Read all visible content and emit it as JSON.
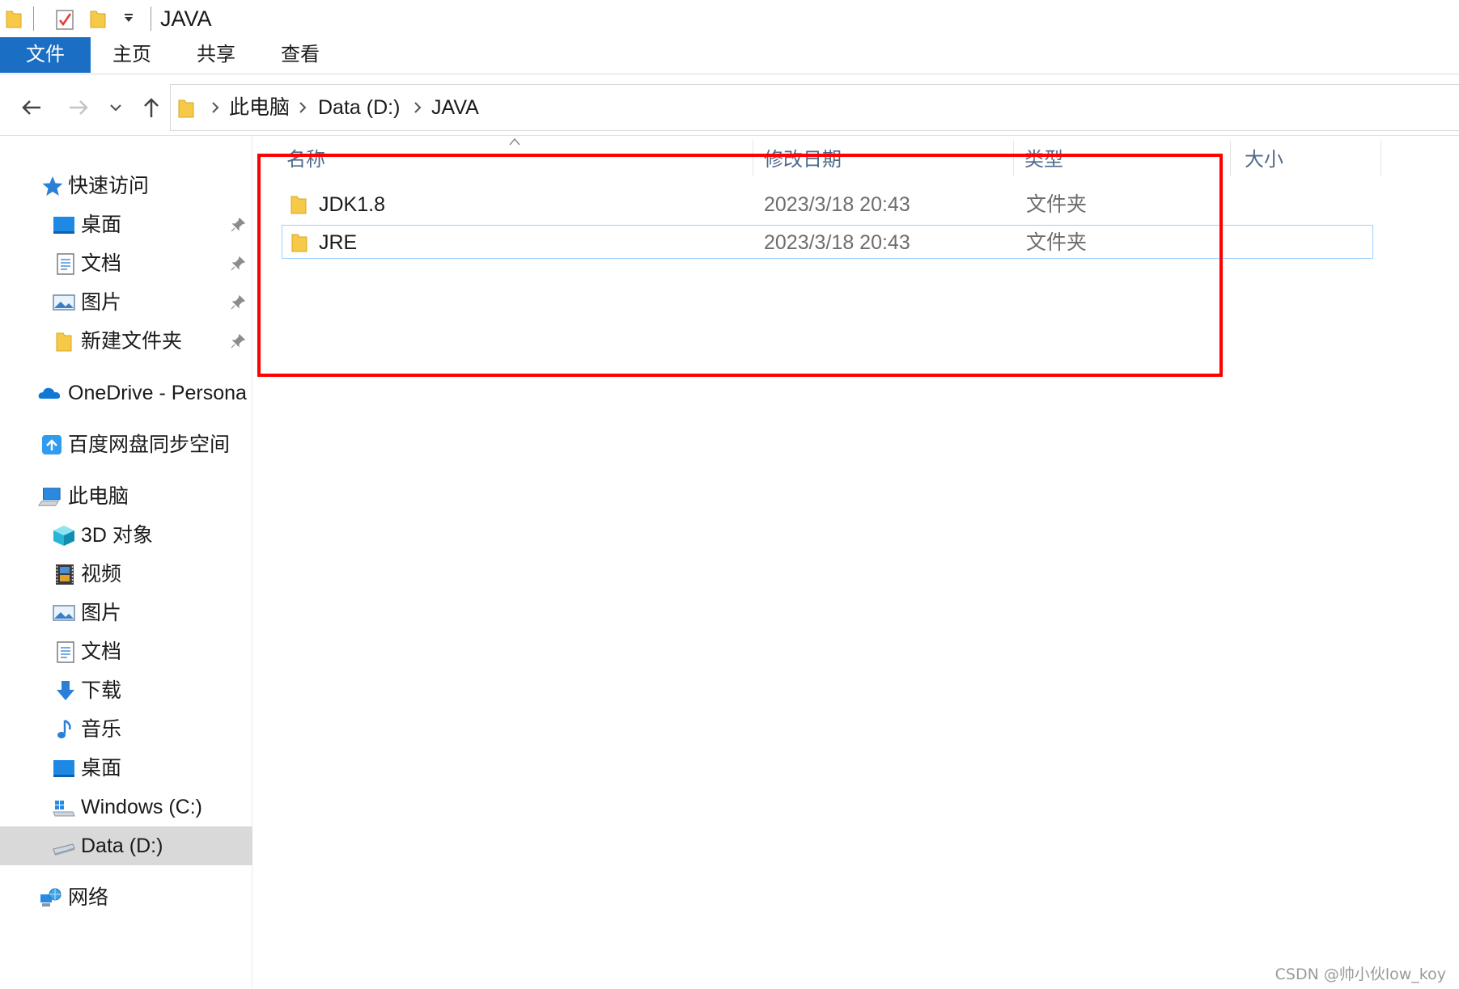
{
  "window": {
    "title": "JAVA"
  },
  "quick_access_toolbar": {
    "icons": [
      "folder-icon",
      "properties-checkmark-icon",
      "new-folder-icon",
      "customize-dropdown-icon"
    ]
  },
  "ribbon": {
    "tabs": [
      {
        "label": "文件",
        "active": true
      },
      {
        "label": "主页"
      },
      {
        "label": "共享"
      },
      {
        "label": "查看"
      }
    ]
  },
  "address_bar": {
    "breadcrumbs": [
      "此电脑",
      "Data (D:)",
      "JAVA"
    ]
  },
  "sidebar": {
    "quick_access": {
      "label": "快速访问",
      "items": [
        {
          "label": "桌面",
          "icon": "desktop-icon",
          "pinned": true
        },
        {
          "label": "文档",
          "icon": "documents-icon",
          "pinned": true
        },
        {
          "label": "图片",
          "icon": "pictures-icon",
          "pinned": true
        },
        {
          "label": "新建文件夹",
          "icon": "folder-icon",
          "pinned": true
        }
      ]
    },
    "onedrive": {
      "label": "OneDrive - Persona"
    },
    "baidu": {
      "label": "百度网盘同步空间"
    },
    "this_pc": {
      "label": "此电脑",
      "items": [
        {
          "label": "3D 对象",
          "icon": "3d-objects-icon"
        },
        {
          "label": "视频",
          "icon": "videos-icon"
        },
        {
          "label": "图片",
          "icon": "pictures-icon"
        },
        {
          "label": "文档",
          "icon": "documents-icon"
        },
        {
          "label": "下载",
          "icon": "downloads-icon"
        },
        {
          "label": "音乐",
          "icon": "music-icon"
        },
        {
          "label": "桌面",
          "icon": "desktop-icon"
        },
        {
          "label": "Windows (C:)",
          "icon": "windows-drive-icon"
        },
        {
          "label": "Data (D:)",
          "icon": "drive-icon",
          "selected": true
        }
      ]
    },
    "network": {
      "label": "网络"
    }
  },
  "file_list": {
    "columns": [
      "名称",
      "修改日期",
      "类型",
      "大小"
    ],
    "rows": [
      {
        "name": "JDK1.8",
        "modified": "2023/3/18 20:43",
        "type": "文件夹",
        "size": ""
      },
      {
        "name": "JRE",
        "modified": "2023/3/18 20:43",
        "type": "文件夹",
        "size": ""
      }
    ]
  },
  "watermark": "CSDN @帅小伙low_koy",
  "colors": {
    "file_tab": "#1a6fc4",
    "highlight_box": "#ff0000",
    "hover_border": "#99d1ff",
    "selected_nav": "#d9d9d9",
    "folder": "#f7c948"
  }
}
